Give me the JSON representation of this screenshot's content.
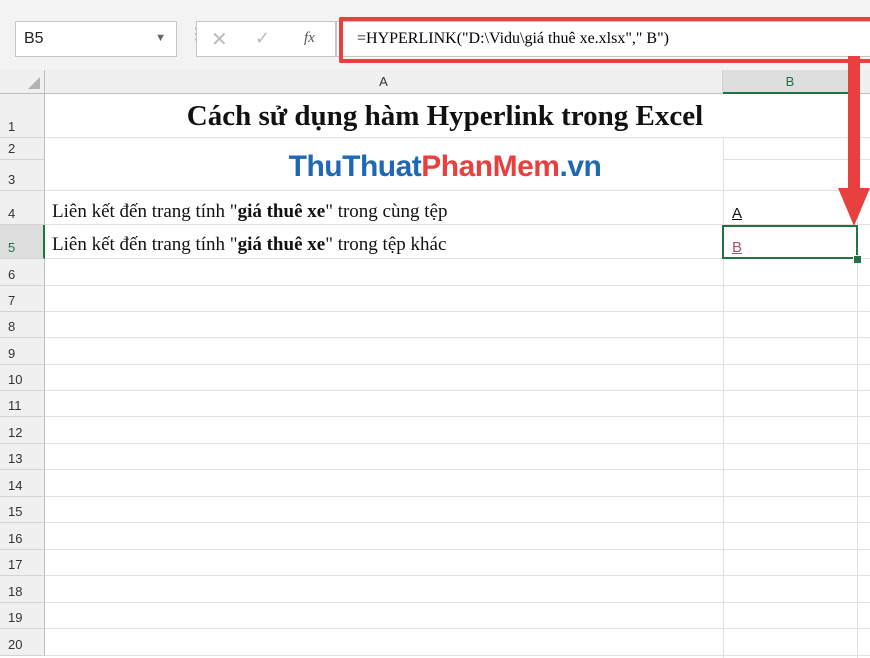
{
  "formula_bar": {
    "name_box": "B5",
    "formula": "=HYPERLINK(\"D:\\Vidu\\giá thuê xe.xlsx\",\" B\")",
    "cancel_icon": "x-icon",
    "enter_icon": "check-icon",
    "function_icon": "fx-icon"
  },
  "columns": [
    "A",
    "B"
  ],
  "rows": [
    "1",
    "2",
    "3",
    "4",
    "5",
    "6",
    "7",
    "8",
    "9",
    "10",
    "11",
    "12",
    "13",
    "14",
    "15",
    "16",
    "17",
    "18",
    "19",
    "20"
  ],
  "cells": {
    "title": "Cách sử dụng hàm Hyperlink trong Excel",
    "brand": {
      "part1": "ThuThuat",
      "part2": "PhanMem",
      "part3": ".vn"
    },
    "a4": {
      "prefix": "Liên kết đến trang tính \"",
      "bold": "giá thuê xe",
      "suffix": "\" trong cùng tệp"
    },
    "a5": {
      "prefix": "Liên kết đến trang tính \"",
      "bold": "giá thuê xe",
      "suffix": "\" trong tệp khác"
    },
    "b4": "A",
    "b5": "B"
  },
  "colors": {
    "accent_green": "#217346",
    "highlight_red": "#e8403e",
    "brand_blue": "#1f68b3"
  }
}
